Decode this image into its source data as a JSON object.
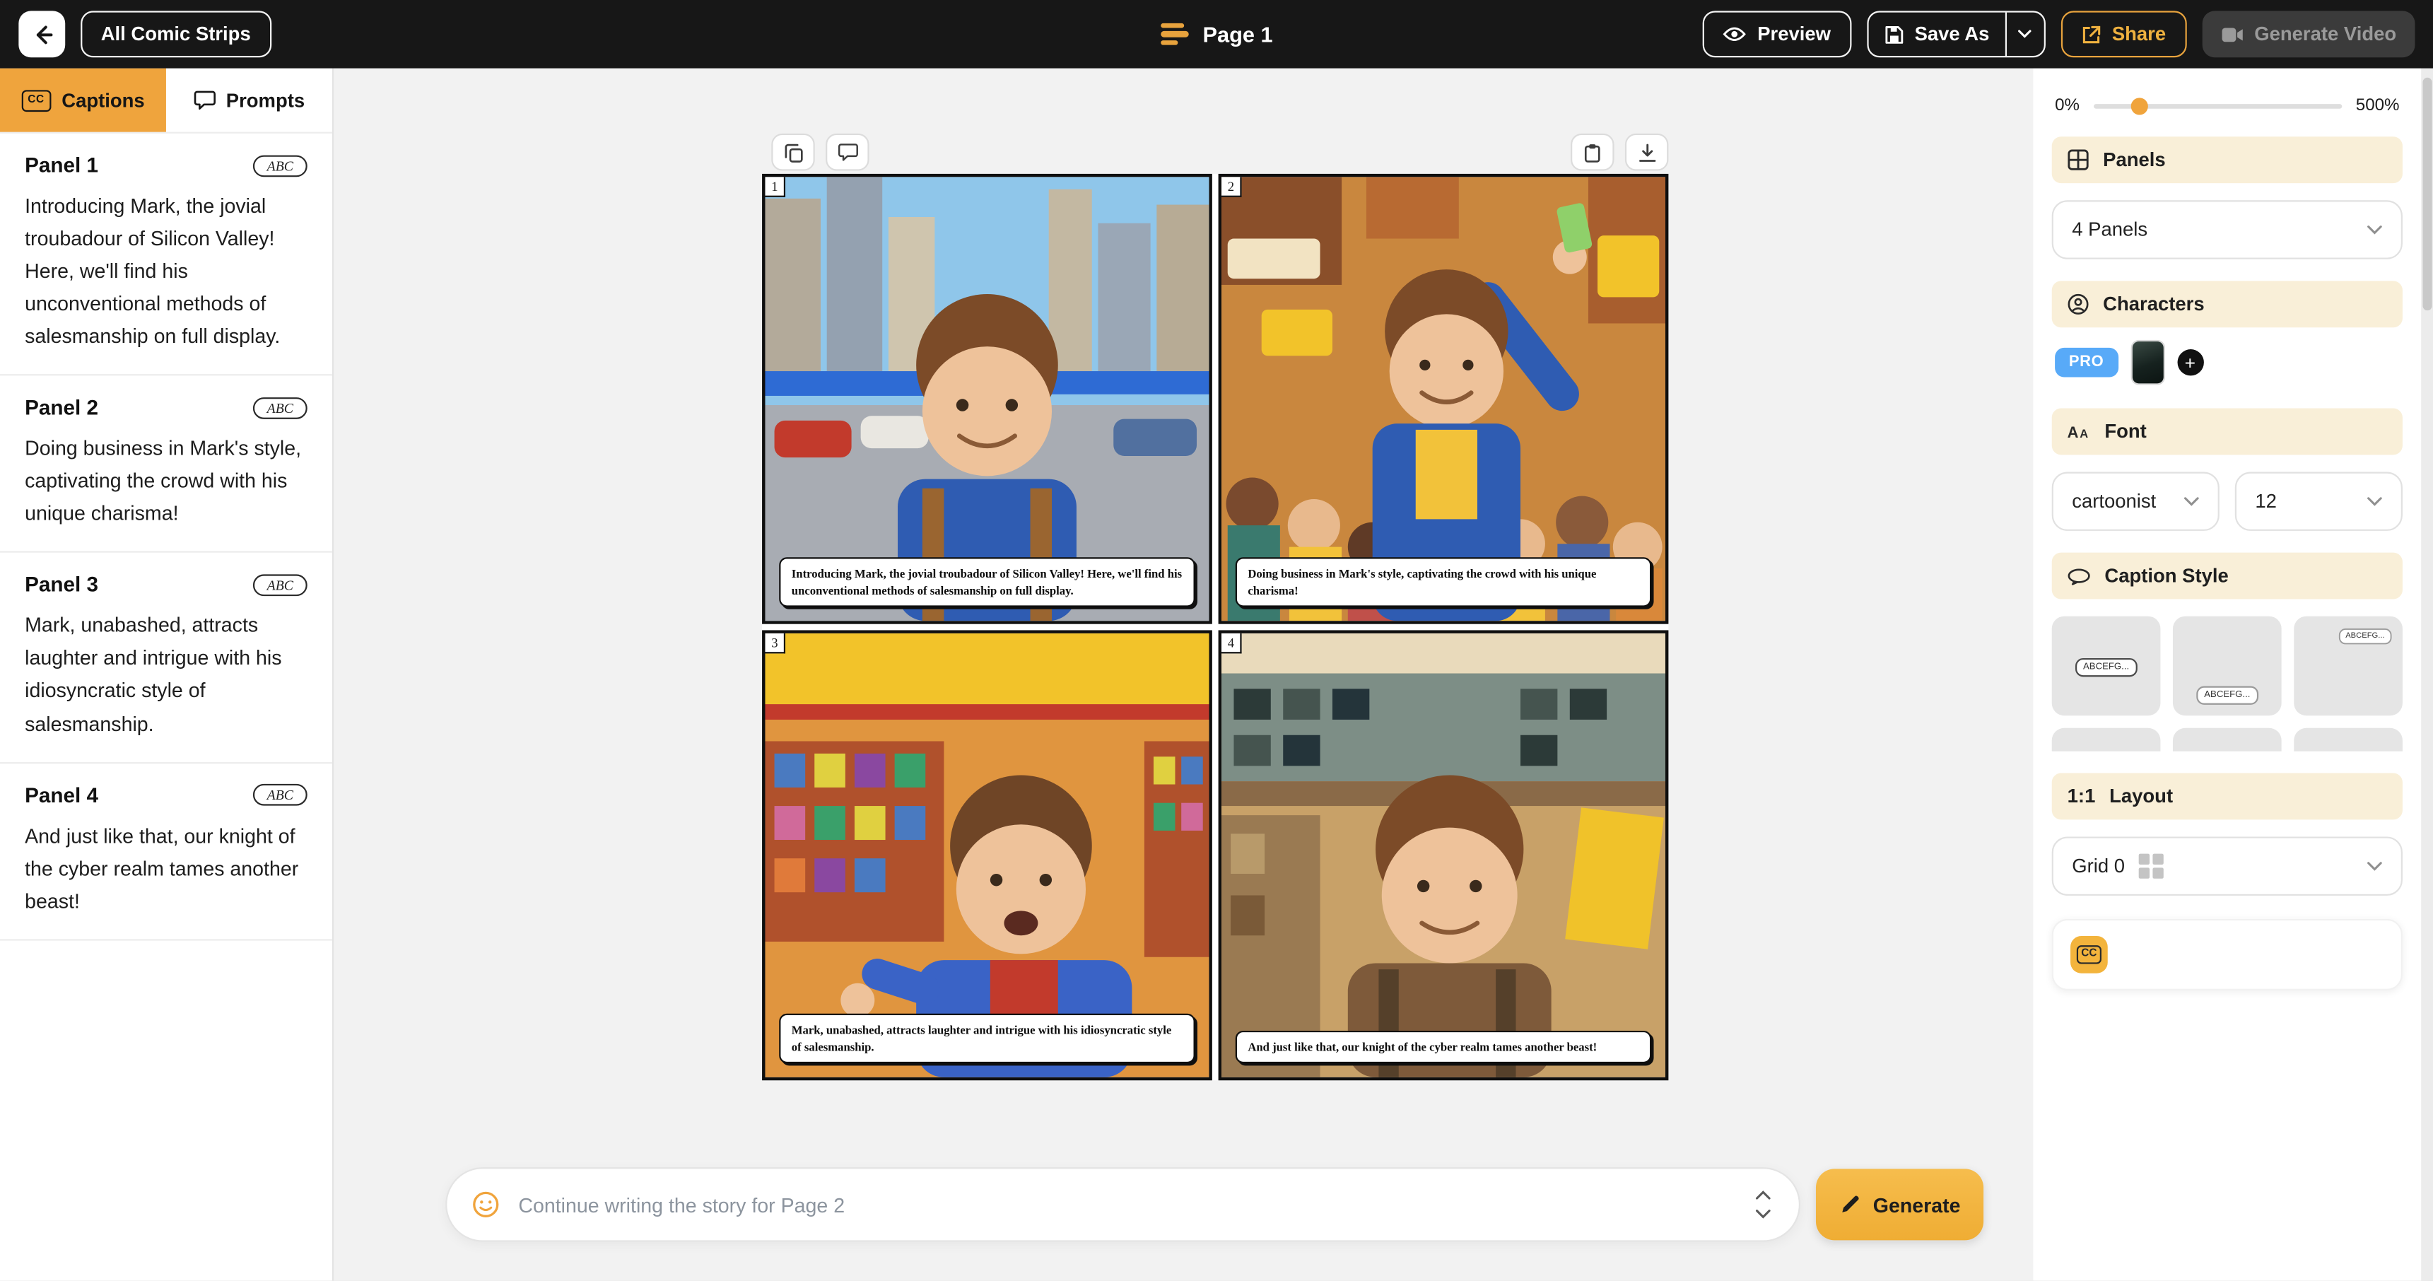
{
  "topbar": {
    "all_comics_label": "All Comic Strips",
    "page_title": "Page 1",
    "preview_label": "Preview",
    "save_as_label": "Save As",
    "share_label": "Share",
    "generate_video_label": "Generate Video"
  },
  "left_sidebar": {
    "tabs": [
      {
        "label": "Captions"
      },
      {
        "label": "Prompts"
      }
    ],
    "panels": [
      {
        "title": "Panel 1",
        "badge": "ABC",
        "text": "Introducing Mark, the jovial troubadour of Silicon Valley! Here, we'll find his unconventional methods of salesmanship on full display."
      },
      {
        "title": "Panel 2",
        "badge": "ABC",
        "text": "Doing business in Mark's style, captivating the crowd with his unique charisma!"
      },
      {
        "title": "Panel 3",
        "badge": "ABC",
        "text": "Mark, unabashed, attracts laughter and intrigue with his idiosyncratic style of salesmanship."
      },
      {
        "title": "Panel 4",
        "badge": "ABC",
        "text": "And just like that, our knight of the cyber realm tames another beast!"
      }
    ]
  },
  "comic": {
    "panels": [
      {
        "number": "1",
        "caption": "Introducing Mark, the jovial troubadour of Silicon Valley! Here, we'll find his unconventional methods of salesmanship on full display."
      },
      {
        "number": "2",
        "caption": "Doing business in Mark's style, captivating the crowd with his unique charisma!"
      },
      {
        "number": "3",
        "caption": "Mark, unabashed, attracts laughter and intrigue with his idiosyncratic style of salesmanship."
      },
      {
        "number": "4",
        "caption": "And just like that, our knight of the cyber realm tames another beast!"
      }
    ]
  },
  "right_sidebar": {
    "zoom": {
      "min_label": "0%",
      "max_label": "500%"
    },
    "panels_section": {
      "title": "Panels",
      "value": "4 Panels"
    },
    "characters_section": {
      "title": "Characters",
      "pro_badge": "PRO"
    },
    "font_section": {
      "title": "Font",
      "family_value": "cartoonist",
      "size_value": "12"
    },
    "caption_style_section": {
      "title": "Caption Style",
      "sample_text": "ABCEFG..."
    },
    "layout_section": {
      "ratio": "1:1",
      "title": "Layout",
      "value": "Grid 0"
    }
  },
  "composer": {
    "placeholder": "Continue writing the story for Page 2",
    "generate_label": "Generate"
  },
  "colors": {
    "accent": "#F0A43C",
    "accent_light": "#F9EFD8",
    "pro_blue": "#58AAF8",
    "topbar_bg": "#171717"
  }
}
